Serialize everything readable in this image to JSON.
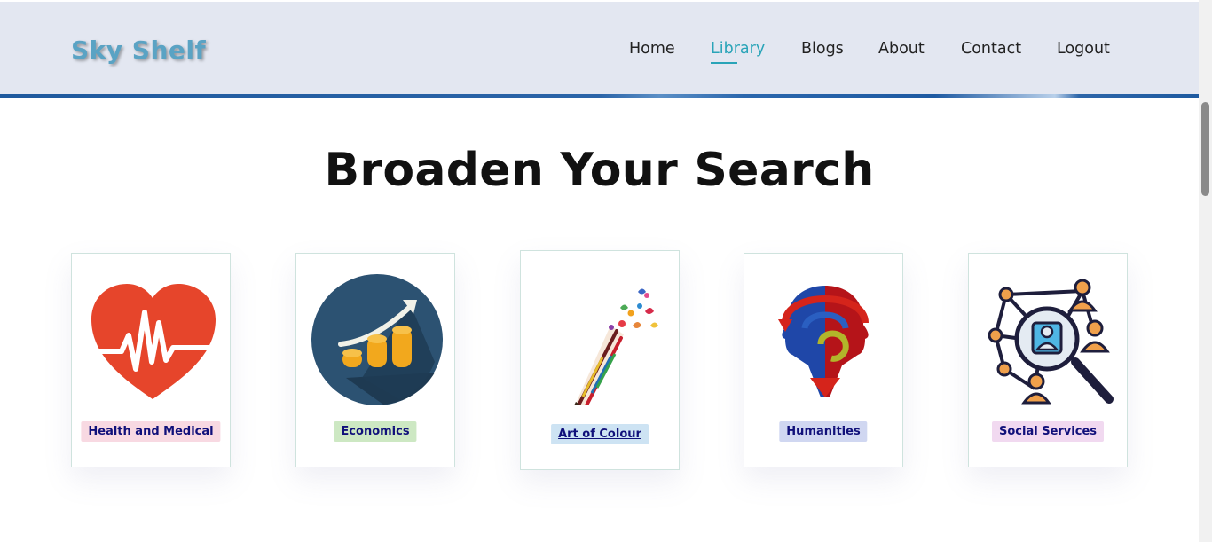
{
  "header": {
    "logo": "Sky Shelf",
    "nav": [
      {
        "label": "Home"
      },
      {
        "label": "Library"
      },
      {
        "label": "Blogs"
      },
      {
        "label": "About"
      },
      {
        "label": "Contact"
      },
      {
        "label": "Logout"
      }
    ]
  },
  "main": {
    "title": "Broaden Your Search",
    "categories": [
      {
        "label": "Health and Medical",
        "icon": "heart-pulse-icon",
        "tag_color": "#f8d9e2"
      },
      {
        "label": "Economics",
        "icon": "growth-coins-icon",
        "tag_color": "#cde8c3"
      },
      {
        "label": "Art of Colour",
        "icon": "paint-brush-butterflies-icon",
        "tag_color": "#cde3f3"
      },
      {
        "label": "Humanities",
        "icon": "head-profiles-icon",
        "tag_color": "#d0d7f1"
      },
      {
        "label": "Social Services",
        "icon": "network-people-icon",
        "tag_color": "#f1d9f0"
      }
    ]
  },
  "colors": {
    "header_bg": "#e3e7f1",
    "accent": "#29a4b8",
    "logo": "#5aa3c4"
  }
}
